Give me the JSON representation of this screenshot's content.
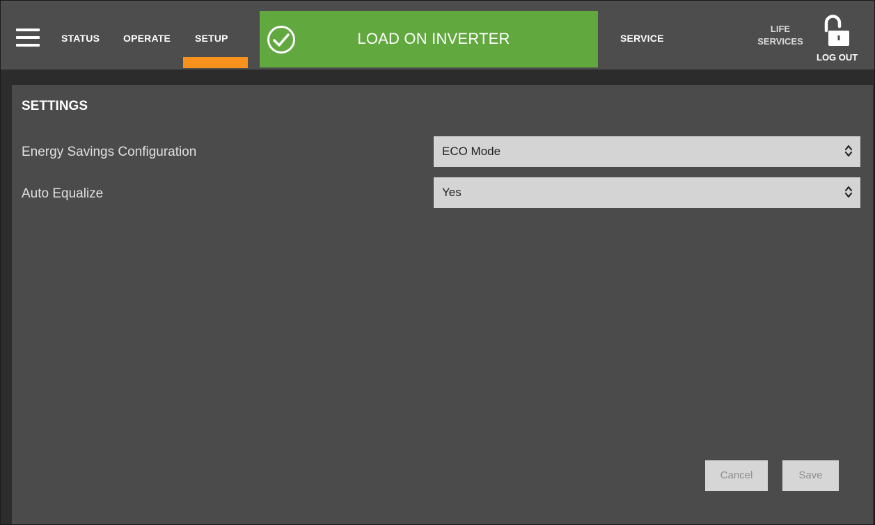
{
  "nav": {
    "items": [
      "STATUS",
      "OPERATE",
      "SETUP"
    ],
    "service": "SERVICE",
    "life_line1": "LIFE",
    "life_line2": "SERVICES",
    "logout": "LOG OUT"
  },
  "banner": {
    "text": "LOAD ON INVERTER",
    "color": "#61a83f"
  },
  "accent_color": "#f7921e",
  "settings": {
    "title": "SETTINGS",
    "rows": [
      {
        "label": "Energy Savings Configuration",
        "value": "ECO Mode"
      },
      {
        "label": "Auto Equalize",
        "value": "Yes"
      }
    ]
  },
  "actions": {
    "cancel": "Cancel",
    "save": "Save"
  },
  "icons": [
    "menu-icon",
    "check-circle-icon",
    "unlocked-padlock-icon",
    "select-arrows-icon"
  ]
}
